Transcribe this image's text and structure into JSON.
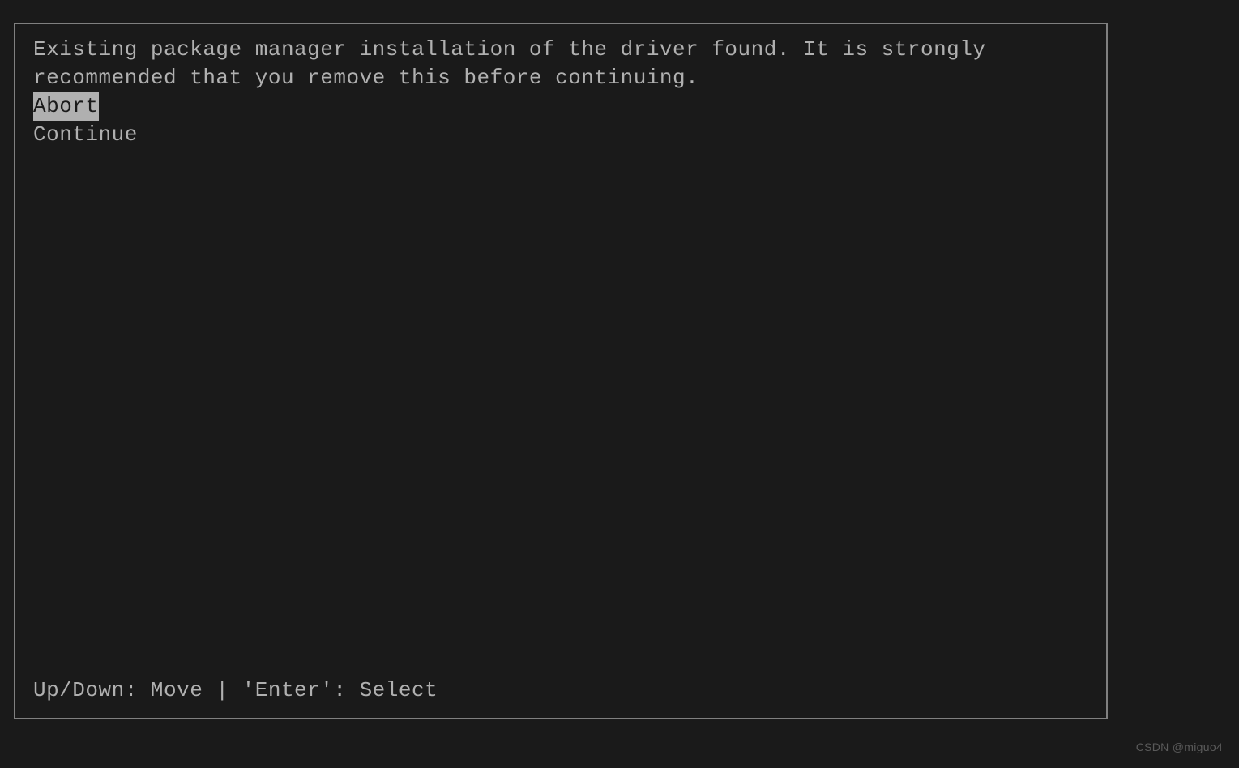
{
  "dialog": {
    "message": "Existing package manager installation of the driver found. It is strongly\nrecommended that you remove this before continuing.",
    "options": [
      {
        "label": "Abort",
        "selected": true
      },
      {
        "label": "Continue",
        "selected": false
      }
    ],
    "footer_hint": "Up/Down: Move | 'Enter': Select"
  },
  "watermark": "CSDN @miguo4"
}
